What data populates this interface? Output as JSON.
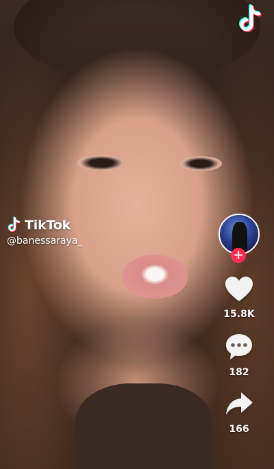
{
  "watermark": {
    "brand": "TikTok",
    "handle": "@banessaraya_"
  },
  "actions": {
    "likes": "15.8K",
    "comments": "182",
    "shares": "166"
  },
  "icons": {
    "corner": "tiktok-logo-icon",
    "like": "heart-icon",
    "comment": "comment-bubble-icon",
    "share": "share-arrow-icon",
    "follow": "plus-icon"
  },
  "colors": {
    "accent_red": "#fe2c55",
    "accent_cyan": "#25f4ee",
    "text": "#ffffff"
  }
}
